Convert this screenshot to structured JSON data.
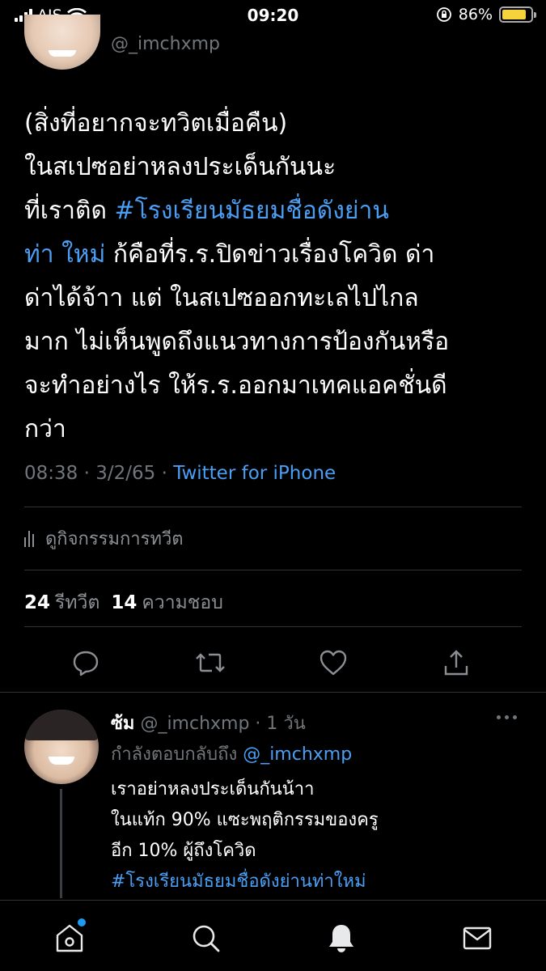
{
  "status_bar": {
    "carrier": "AIS",
    "time": "09:20",
    "battery_percent": "86%",
    "battery_level": 0.86,
    "battery_color": "#f5d33a"
  },
  "tweet": {
    "handle": "@_imchxmp",
    "text_lines": [
      [
        {
          "t": "(สิ่งที่อยากจะทวิตเมื่อคืน)",
          "link": false
        }
      ],
      [
        {
          "t": " ในสเปซอย่าหลงประเด็นกันนะ",
          "link": false
        }
      ],
      [
        {
          "t": "ที่เราติด ",
          "link": false
        },
        {
          "t": "#โรงเรียนมัธยมชื่อดังย่าน",
          "link": true
        }
      ],
      [
        {
          "t": "ท่า ใหม่",
          "link": true
        },
        {
          "t": " ก้คือที่ร.ร.ปิดข่าวเรื่องโควิด ด่า",
          "link": false
        }
      ],
      [
        {
          "t": "ด่าได้จ้าา แต่ ในสเปซออกทะเลไปไกล",
          "link": false
        }
      ],
      [
        {
          "t": "มาก ไม่เห็นพูดถึงแนวทางการป้องกันหรือ",
          "link": false
        }
      ],
      [
        {
          "t": "จะทำอย่างไร ให้ร.ร.ออกมาเทคแอคชั่นดี",
          "link": false
        }
      ],
      [
        {
          "t": "กว่า",
          "link": false
        }
      ]
    ],
    "time": "08:38",
    "date": "3/2/65",
    "via": "Twitter for iPhone",
    "activity_label": "ดูกิจกรรมการทวีต",
    "retweet_count": "24",
    "retweet_label": "รีทวีต",
    "like_count": "14",
    "like_label": "ความชอบ"
  },
  "reply": {
    "name": "ซ้ม",
    "handle": "@_imchxmp",
    "age": "1 วัน",
    "replying_to_prefix": "กำลังตอบกลับถึง ",
    "replying_to_handle": "@_imchxmp",
    "text_lines": [
      [
        {
          "t": "เราอย่าหลงประเด็นกันน้าา",
          "link": false
        }
      ],
      [
        {
          "t": "ในแท้ก 90% แซะพฤติกรรมของครู",
          "link": false
        }
      ],
      [
        {
          "t": "อีก 10% ผู้ถึงโควิด",
          "link": false
        }
      ],
      [
        {
          "t": "#โรงเรียนมัธยมชื่อดังย่านท่าใหม่",
          "link": true
        }
      ]
    ]
  },
  "tabbar": {
    "items": [
      "home-icon",
      "search-icon",
      "notifications-icon",
      "messages-icon"
    ],
    "accent": "#1d9bf0"
  }
}
